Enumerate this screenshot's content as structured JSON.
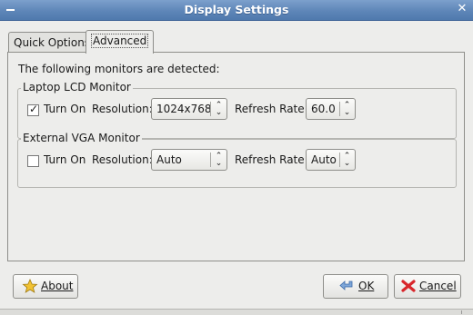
{
  "window": {
    "title": "Display Settings"
  },
  "tabs": [
    {
      "label": "Quick Options",
      "active": false
    },
    {
      "label": "Advanced",
      "active": true
    }
  ],
  "advanced": {
    "intro_text": "The following monitors are detected:",
    "monitors": [
      {
        "name": "Laptop LCD Monitor",
        "turn_on_label": "Turn On",
        "turn_on_checked": true,
        "resolution_label": "Resolution:",
        "resolution_value": "1024x768",
        "refresh_label": "Refresh Rate:",
        "refresh_value": "60.0"
      },
      {
        "name": "External VGA Monitor",
        "turn_on_label": "Turn On",
        "turn_on_checked": false,
        "resolution_label": "Resolution:",
        "resolution_value": "Auto",
        "refresh_label": "Refresh Rate:",
        "refresh_value": "Auto"
      }
    ]
  },
  "buttons": {
    "about": "About",
    "ok": "OK",
    "cancel": "Cancel"
  },
  "icons": {
    "window_menu": "minus-icon",
    "close": "close-icon",
    "about": "star-icon",
    "ok": "back-arrow-icon",
    "cancel": "cancel-x-icon",
    "combo_arrows": "up-down-arrow-icon"
  },
  "colors": {
    "titlebar": "#5e86b8",
    "dialog_bg": "#ededeb",
    "cancel_icon": "#d8262b",
    "about_icon": "#f1c232"
  }
}
